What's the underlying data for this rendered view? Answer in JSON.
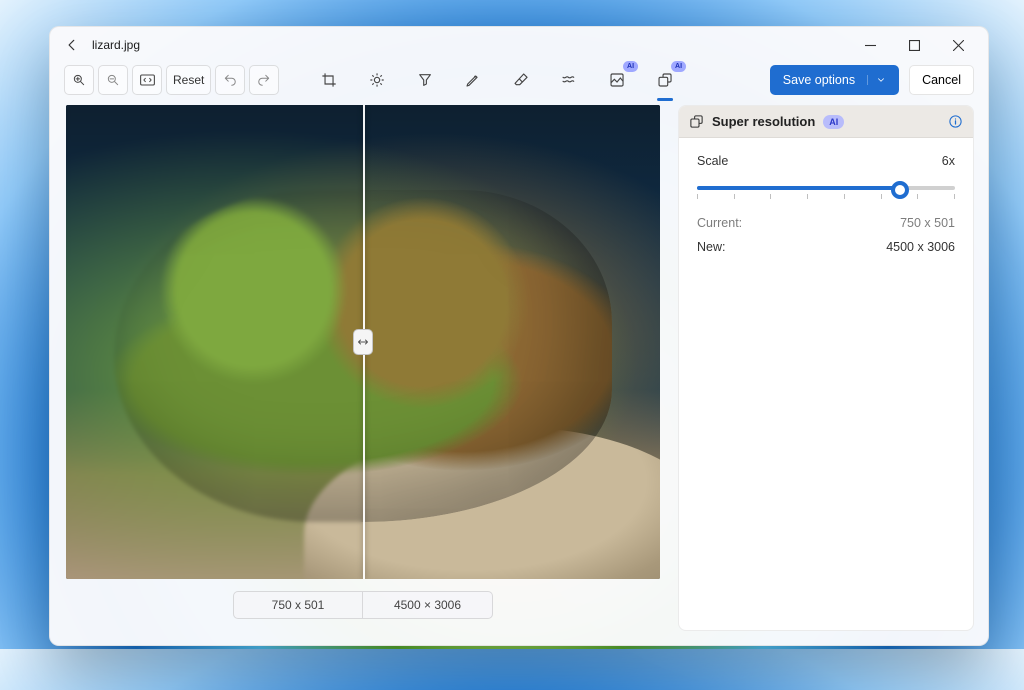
{
  "title": "lizard.jpg",
  "toolbar": {
    "reset": "Reset",
    "save": "Save options",
    "cancel": "Cancel",
    "ai_badge": "AI"
  },
  "side": {
    "title": "Super resolution",
    "ai_badge": "AI",
    "scale_label": "Scale",
    "scale_value": "6x",
    "current_label": "Current:",
    "current_value": "750 x 501",
    "new_label": "New:",
    "new_value": "4500 x 3006"
  },
  "canvas": {
    "before_dim": "750 x 501",
    "after_dim": "4500 × 3006"
  }
}
